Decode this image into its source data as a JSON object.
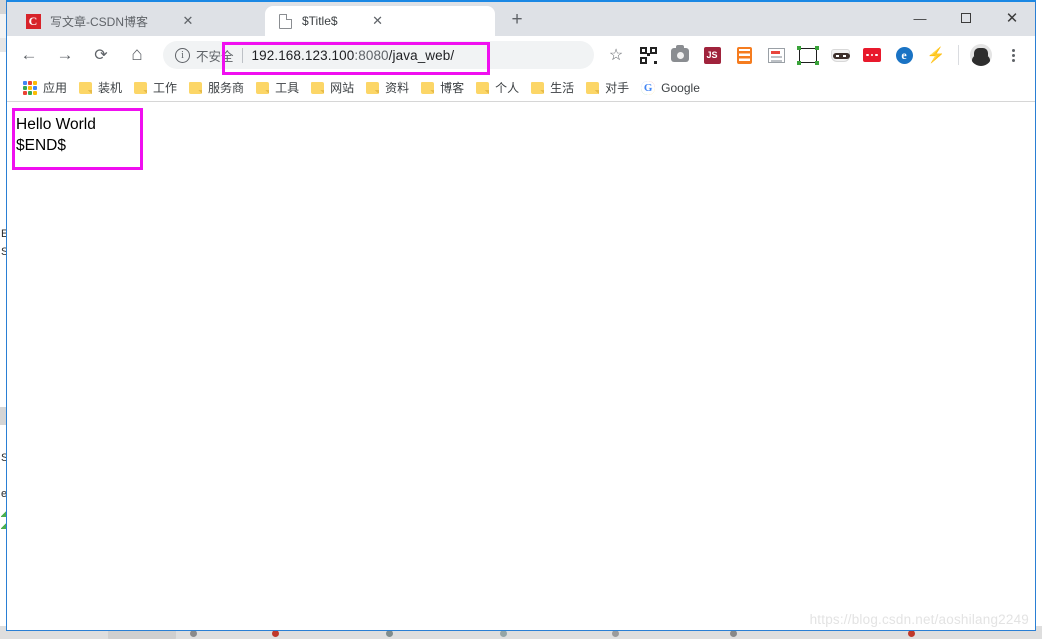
{
  "window": {
    "controls": {
      "minimize": "—",
      "maximize": "□",
      "close": "✕"
    }
  },
  "tabs": [
    {
      "title": "写文章-CSDN博客",
      "favicon": "csdn-favicon",
      "favicon_letter": "C",
      "close": "✕",
      "active": false
    },
    {
      "title": "$Title$",
      "favicon": "document-favicon",
      "close": "✕",
      "active": true
    }
  ],
  "newtab": {
    "label": "+"
  },
  "toolbar": {
    "back": "←",
    "forward": "→",
    "reload": "⟳",
    "home": "⌂",
    "star": "☆",
    "bolt": "⚡",
    "extensions": [
      {
        "name": "qr-code-icon"
      },
      {
        "name": "camera-icon"
      },
      {
        "name": "js-icon",
        "label": "JS"
      },
      {
        "name": "list-icon"
      },
      {
        "name": "note-icon"
      },
      {
        "name": "screenshot-crop-icon"
      },
      {
        "name": "masked-face-icon"
      },
      {
        "name": "red-dots-icon"
      },
      {
        "name": "e-circle-icon",
        "label": "e"
      }
    ]
  },
  "omnibox": {
    "security_icon": "ⓘ",
    "security_text": "不安全",
    "url_host": "192.168.123.100",
    "url_port": ":8080",
    "url_path": "/java_web/",
    "full_url": "192.168.123.100:8080/java_web/"
  },
  "bookmarks": {
    "apps_label": "应用",
    "items": [
      {
        "label": "装机",
        "icon": "folder-icon"
      },
      {
        "label": "工作",
        "icon": "folder-icon"
      },
      {
        "label": "服务商",
        "icon": "folder-icon"
      },
      {
        "label": "工具",
        "icon": "folder-icon"
      },
      {
        "label": "网站",
        "icon": "folder-icon"
      },
      {
        "label": "资料",
        "icon": "folder-icon"
      },
      {
        "label": "博客",
        "icon": "folder-icon"
      },
      {
        "label": "个人",
        "icon": "folder-icon"
      },
      {
        "label": "生活",
        "icon": "folder-icon"
      },
      {
        "label": "对手",
        "icon": "folder-icon"
      },
      {
        "label": "Google",
        "icon": "google-icon"
      }
    ]
  },
  "page": {
    "content": "Hello World\n$END$",
    "watermark": "https://blog.csdn.net/aoshilang2249"
  },
  "background": {
    "glyph_e": "E",
    "glyph_s": "S",
    "glyph_se": "Se",
    "glyph_e2": "e"
  },
  "colors": {
    "highlight": "#f00ff0",
    "titlebar": "#dee1e6",
    "accent_border": "#2a7fd4",
    "bookmark_folder": "#fcd667"
  }
}
